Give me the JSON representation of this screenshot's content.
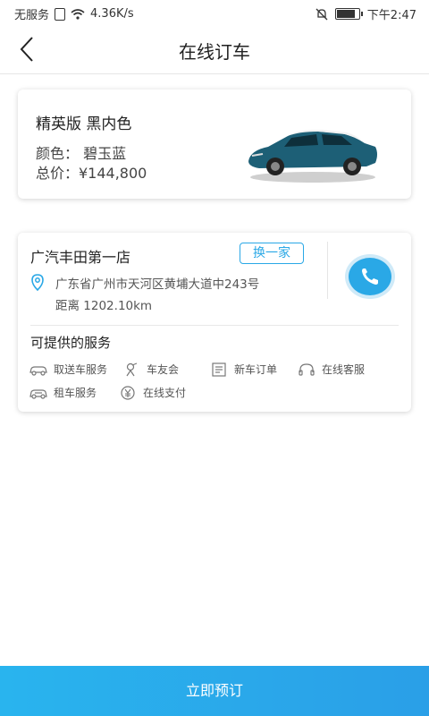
{
  "status_bar": {
    "carrier": "无服务",
    "speed": "4.36K/s",
    "time": "下午2:47",
    "icons": [
      "sim-icon",
      "wifi-icon",
      "mute-icon",
      "battery-icon"
    ]
  },
  "header": {
    "title": "在线订车",
    "back_icon": "chevron-left-icon"
  },
  "car": {
    "version": "精英版 黑内色",
    "color_line": "颜色： 碧玉蓝",
    "price_line": "总价：¥144,800",
    "body_color": "#1d5f76"
  },
  "dealer": {
    "name": "广汽丰田第一店",
    "change_label": "换一家",
    "address": "广东省广州市天河区黄埔大道中243号",
    "distance": "距离   1202.10km",
    "services_title": "可提供的服务",
    "services": [
      {
        "label": "取送车服务",
        "icon": "car-delivery-icon"
      },
      {
        "label": "车友会",
        "icon": "club-icon"
      },
      {
        "label": "新车订单",
        "icon": "order-icon"
      },
      {
        "label": "在线客服",
        "icon": "headset-icon"
      },
      {
        "label": "租车服务",
        "icon": "car-rental-icon"
      },
      {
        "label": "在线支付",
        "icon": "yen-icon"
      }
    ]
  },
  "footer": {
    "order_label": "立即预订"
  },
  "colors": {
    "accent": "#2aa8e6",
    "text": "#222222"
  }
}
